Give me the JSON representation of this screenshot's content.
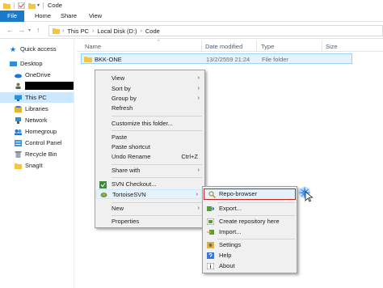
{
  "window": {
    "title": "Code"
  },
  "ribbon": {
    "tabs": [
      "File",
      "Home",
      "Share",
      "View"
    ]
  },
  "address": {
    "crumbs": [
      "This PC",
      "Local Disk (D:)",
      "Code"
    ]
  },
  "nav": {
    "items": [
      "Quick access",
      "Desktop",
      "OneDrive",
      "",
      "This PC",
      "Libraries",
      "Network",
      "Homegroup",
      "Control Panel",
      "Recycle Bin",
      "SnagIt"
    ]
  },
  "columns": {
    "name": "Name",
    "date": "Date modified",
    "type": "Type",
    "size": "Size"
  },
  "files": [
    {
      "name": "BKK-ONE",
      "date": "13/2/2559 21:24",
      "type": "File folder"
    }
  ],
  "context_menu": {
    "view": "View",
    "sort_by": "Sort by",
    "group_by": "Group by",
    "refresh": "Refresh",
    "customize": "Customize this folder...",
    "paste": "Paste",
    "paste_shortcut": "Paste shortcut",
    "undo_rename": "Undo Rename",
    "undo_shortcut": "Ctrl+Z",
    "share_with": "Share with",
    "svn_checkout": "SVN Checkout...",
    "tortoise": "TortoiseSVN",
    "new": "New",
    "properties": "Properties"
  },
  "submenu": {
    "repo_browser": "Repo-browser",
    "export": "Export...",
    "create_repo": "Create repository here",
    "import": "Import...",
    "settings": "Settings",
    "help": "Help",
    "about": "About"
  },
  "colors": {
    "accent": "#1979ca",
    "selection": "#cce8ff",
    "highlight_border": "#cc2020",
    "folder": "#f4c542"
  }
}
